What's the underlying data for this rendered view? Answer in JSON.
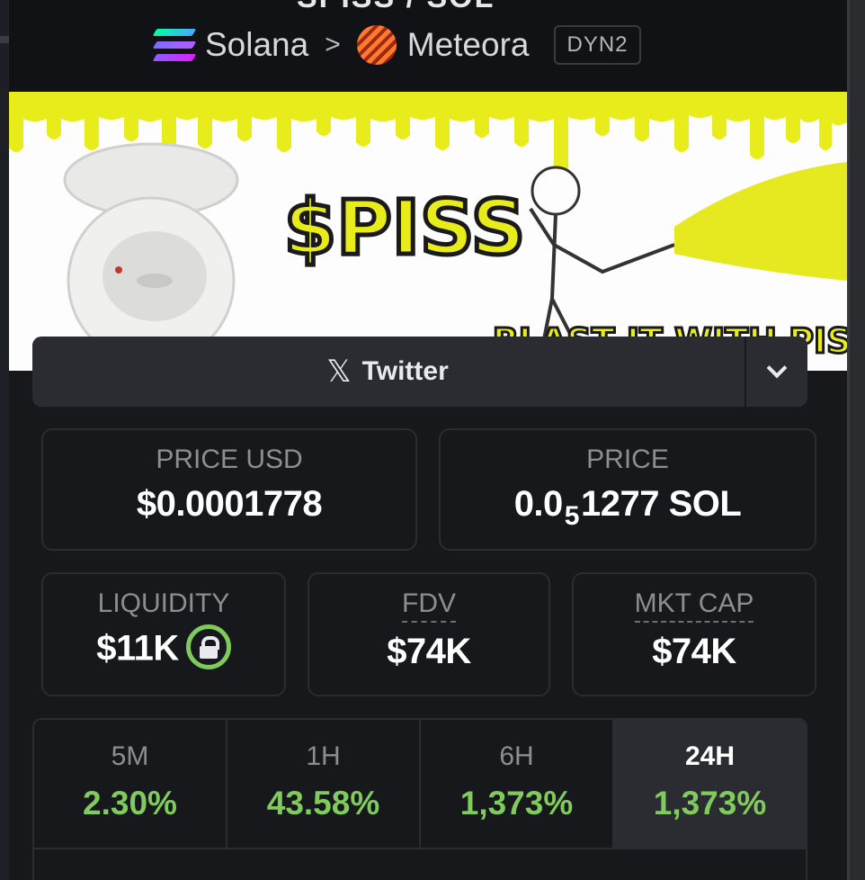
{
  "header": {
    "title_fragment": "SPISS / SOL",
    "chain": "Solana",
    "dex": "Meteora",
    "pool_type": "DYN2"
  },
  "banner": {
    "ticker": "$PISS",
    "tagline": "BLAST IT WITH PISS"
  },
  "socials": {
    "twitter_label": "Twitter"
  },
  "price": {
    "usd_label": "PRICE USD",
    "usd_value": "$0.0001778",
    "native_label": "PRICE",
    "native_prefix": "0.0",
    "native_sub": "5",
    "native_suffix": "1277 SOL"
  },
  "metrics": {
    "liquidity_label": "LIQUIDITY",
    "liquidity_value": "$11K",
    "fdv_label": "FDV",
    "fdv_value": "$74K",
    "mktcap_label": "MKT CAP",
    "mktcap_value": "$74K"
  },
  "changes": [
    {
      "label": "5M",
      "value": "2.30%"
    },
    {
      "label": "1H",
      "value": "43.58%"
    },
    {
      "label": "6H",
      "value": "1,373%"
    },
    {
      "label": "24H",
      "value": "1,373%"
    }
  ],
  "colors": {
    "positive": "#7fcb5b",
    "banner_yellow": "#e8ec1a",
    "panel": "#17181c"
  }
}
